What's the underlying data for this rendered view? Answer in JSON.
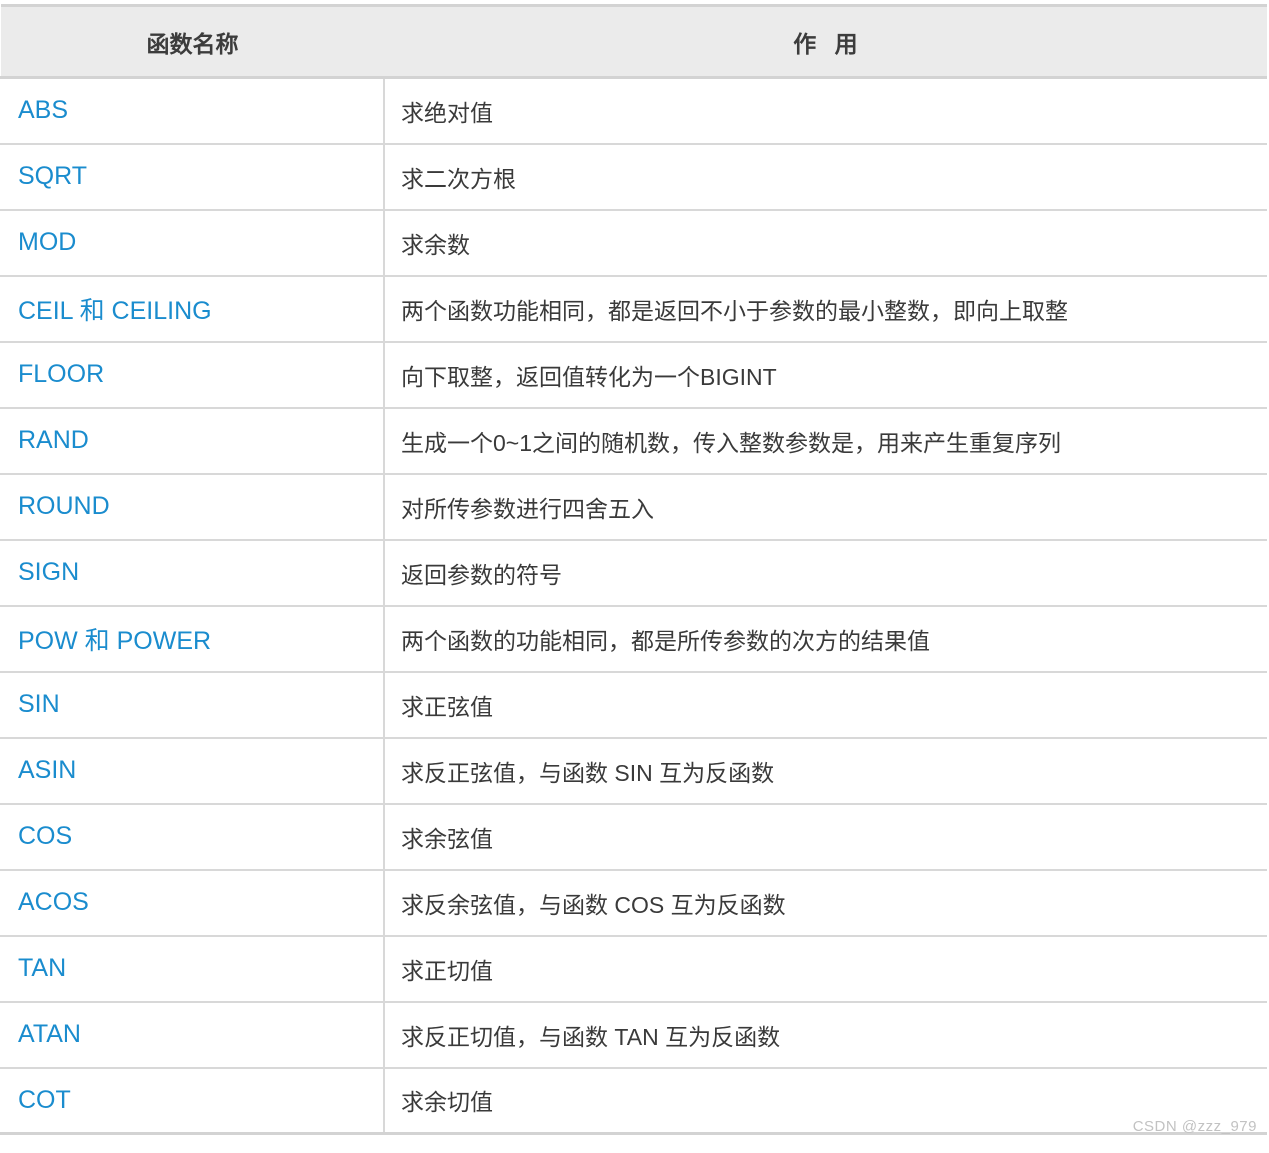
{
  "table": {
    "columns": [
      {
        "key": "name",
        "label": "函数名称"
      },
      {
        "key": "desc",
        "label": "作 用"
      }
    ],
    "rows": [
      {
        "name": "ABS",
        "desc": "求绝对值"
      },
      {
        "name": "SQRT",
        "desc": "求二次方根"
      },
      {
        "name": "MOD",
        "desc": "求余数"
      },
      {
        "name": "CEIL 和 CEILING",
        "desc": "两个函数功能相同，都是返回不小于参数的最小整数，即向上取整"
      },
      {
        "name": "FLOOR",
        "desc": "向下取整，返回值转化为一个BIGINT"
      },
      {
        "name": "RAND",
        "desc": "生成一个0~1之间的随机数，传入整数参数是，用来产生重复序列"
      },
      {
        "name": "ROUND",
        "desc": "对所传参数进行四舍五入"
      },
      {
        "name": "SIGN",
        "desc": "返回参数的符号"
      },
      {
        "name": "POW 和 POWER",
        "desc": "两个函数的功能相同，都是所传参数的次方的结果值"
      },
      {
        "name": "SIN",
        "desc": "求正弦值"
      },
      {
        "name": "ASIN",
        "desc": "求反正弦值，与函数 SIN 互为反函数"
      },
      {
        "name": "COS",
        "desc": "求余弦值"
      },
      {
        "name": "ACOS",
        "desc": "求反余弦值，与函数 COS 互为反函数"
      },
      {
        "name": "TAN",
        "desc": "求正切值"
      },
      {
        "name": "ATAN",
        "desc": "求反正切值，与函数 TAN 互为反函数"
      },
      {
        "name": "COT",
        "desc": "求余切值"
      }
    ]
  },
  "watermark": {
    "text": "CSDN @zzz_979"
  },
  "colors": {
    "function_name": "#1a8cce",
    "description": "#3a3a3a",
    "header_background": "#ebebeb",
    "header_text": "#3c3c3c",
    "border": "#d8d8d8",
    "watermark": "#c2c2c2"
  }
}
